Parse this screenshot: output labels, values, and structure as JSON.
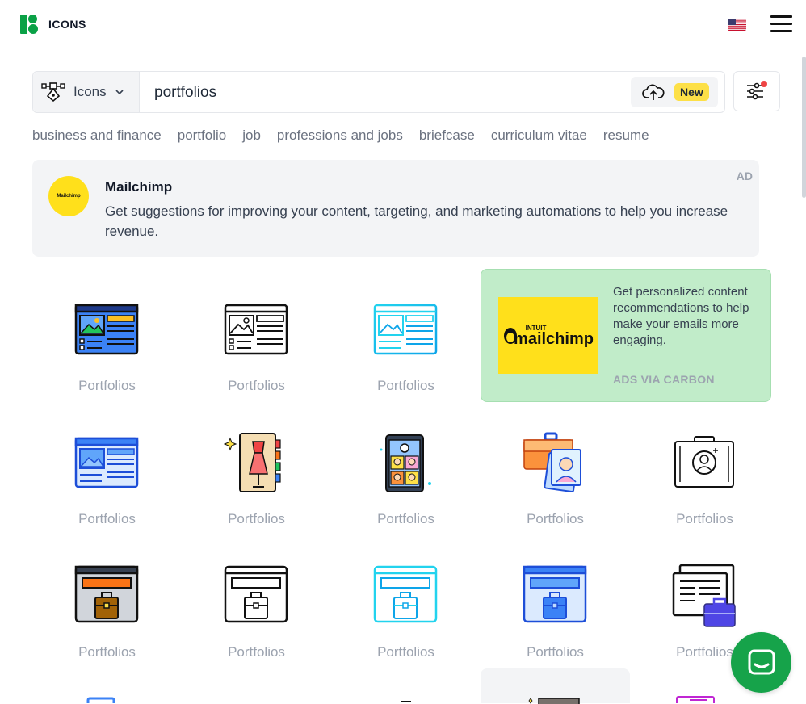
{
  "header": {
    "logo_text": "ICONS",
    "flag_icon": "us-flag-icon",
    "menu_icon": "hamburger-icon"
  },
  "search": {
    "type_label": "Icons",
    "query": "portfolios",
    "placeholder": "",
    "new_badge": "New"
  },
  "tags": [
    "business and finance",
    "portfolio",
    "job",
    "professions and jobs",
    "briefcase",
    "curriculum vitae",
    "resume"
  ],
  "ad": {
    "title": "Mailchimp",
    "description": "Get suggestions for improving your content, targeting, and marketing automations to help you increase revenue.",
    "tag": "AD",
    "logo_text": "Mailchimp"
  },
  "carbon": {
    "brand_small": "INTUIT",
    "brand": "mailchimp",
    "text": "Get personalized content recommendations to help make your emails more engaging.",
    "via": "ADS VIA CARBON"
  },
  "icons": [
    {
      "caption": "Portfolios"
    },
    {
      "caption": "Portfolios"
    },
    {
      "caption": "Portfolios"
    },
    {
      "caption": "Portfolios"
    },
    {
      "caption": "Portfolios"
    },
    {
      "caption": "Portfolios"
    },
    {
      "caption": "Portfolios"
    },
    {
      "caption": "Portfolios"
    },
    {
      "caption": "Portfolios"
    },
    {
      "caption": "Portfolios"
    },
    {
      "caption": "Portfolios"
    },
    {
      "caption": "Portfolios"
    },
    {
      "caption": "Portfolios"
    }
  ],
  "colors": {
    "brand_green": "#0aa146",
    "chat_green": "#16a34a",
    "new_badge": "#fde047",
    "carbon_bg": "#c1ecc9"
  }
}
